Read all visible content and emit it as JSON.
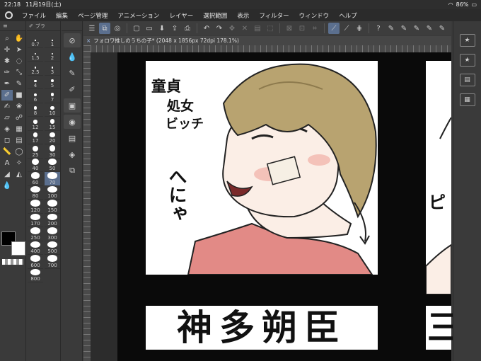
{
  "status": {
    "time": "22:18",
    "date": "11月19日(土)",
    "battery": "86%"
  },
  "menu": [
    "ファイル",
    "編集",
    "ページ管理",
    "アニメーション",
    "レイヤー",
    "選択範囲",
    "表示",
    "フィルター",
    "ウィンドウ",
    "ヘルプ"
  ],
  "document": {
    "tab_title": "フォロワ推しのうちの子* (2048 x 1856px 72dpi 178.1%)"
  },
  "brush_panel": {
    "header": "ブラ"
  },
  "brush_sizes": [
    "0.7",
    "1",
    "1.5",
    "2",
    "2.5",
    "3",
    "4",
    "5",
    "6",
    "7",
    "8",
    "10",
    "12",
    "15",
    "17",
    "20",
    "25",
    "30",
    "40",
    "50",
    "60",
    "70",
    "80",
    "100",
    "120",
    "150",
    "170",
    "200",
    "250",
    "300",
    "400",
    "500",
    "600",
    "700",
    "800"
  ],
  "brush_selected": "70",
  "artwork": {
    "text_top_left": [
      "童貞",
      "処女",
      "ビッチ"
    ],
    "text_side": "へにゃ",
    "name_caption": "神多朔臣",
    "panel2_side": "ピ",
    "panel2_name": "三"
  },
  "colors": {
    "accent": "#5b6f8e",
    "hair": "#b8a370",
    "shirt": "#e28a86",
    "skin": "#fbeee6"
  }
}
